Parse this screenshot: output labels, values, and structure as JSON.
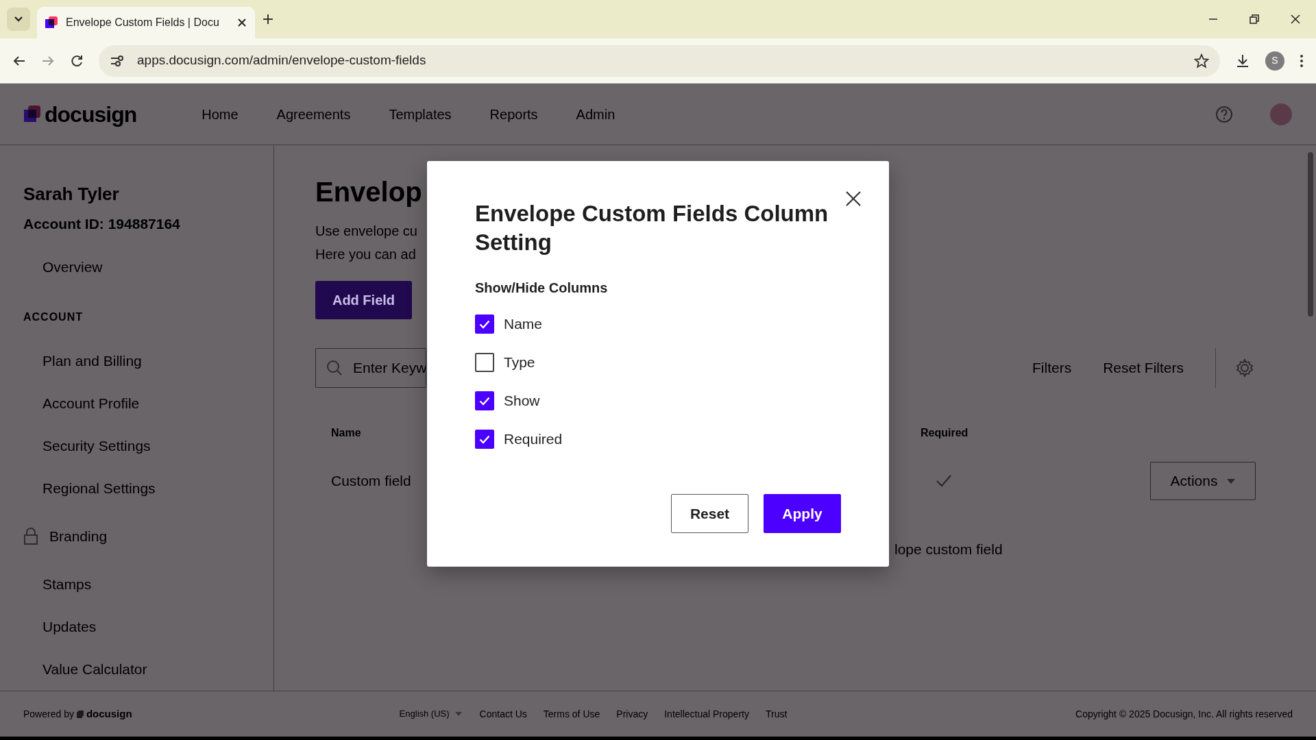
{
  "browser": {
    "tab_title": "Envelope Custom Fields | Docu",
    "url": "apps.docusign.com/admin/envelope-custom-fields",
    "profile_initial": "S"
  },
  "app": {
    "logo": "docusign",
    "nav": [
      {
        "label": "Home"
      },
      {
        "label": "Agreements"
      },
      {
        "label": "Templates"
      },
      {
        "label": "Reports"
      },
      {
        "label": "Admin"
      }
    ]
  },
  "sidebar": {
    "user_name": "Sarah Tyler",
    "account_id": "Account ID: 194887164",
    "items": [
      {
        "label": "Overview",
        "kind": "link"
      },
      {
        "label": "ACCOUNT",
        "kind": "heading"
      },
      {
        "label": "Plan and Billing",
        "kind": "link"
      },
      {
        "label": "Account Profile",
        "kind": "link"
      },
      {
        "label": "Security Settings",
        "kind": "link"
      },
      {
        "label": "Regional Settings",
        "kind": "link"
      },
      {
        "label": "Branding",
        "kind": "locked"
      },
      {
        "label": "Stamps",
        "kind": "link"
      },
      {
        "label": "Updates",
        "kind": "link"
      },
      {
        "label": "Value Calculator",
        "kind": "link"
      }
    ]
  },
  "main": {
    "title": "Envelop",
    "description": [
      "Use envelope cu",
      "Here you can ad"
    ],
    "add_button": "Add Field",
    "search_placeholder": "Enter Keyw",
    "filters_button": "Filters",
    "reset_filters": "Reset Filters",
    "columns": [
      "Name",
      "Required"
    ],
    "rows": [
      {
        "name": "Custom field",
        "required": true,
        "actions": "Actions"
      }
    ],
    "partial_row": "lope custom field"
  },
  "dialog": {
    "title": "Envelope Custom Fields Column Setting",
    "section": "Show/Hide Columns",
    "options": [
      {
        "label": "Name",
        "checked": true
      },
      {
        "label": "Type",
        "checked": false
      },
      {
        "label": "Show",
        "checked": true
      },
      {
        "label": "Required",
        "checked": true
      }
    ],
    "buttons": [
      {
        "label": "Reset",
        "kind": "secondary"
      },
      {
        "label": "Apply",
        "kind": "primary"
      }
    ]
  },
  "footer": {
    "powered_by": "Powered by",
    "logo": "docusign",
    "language": "English (US)",
    "links": [
      "Contact Us",
      "Terms of Use",
      "Privacy",
      "Intellectual Property",
      "Trust"
    ],
    "copyright": "Copyright © 2025 Docusign, Inc. All rights reserved"
  }
}
